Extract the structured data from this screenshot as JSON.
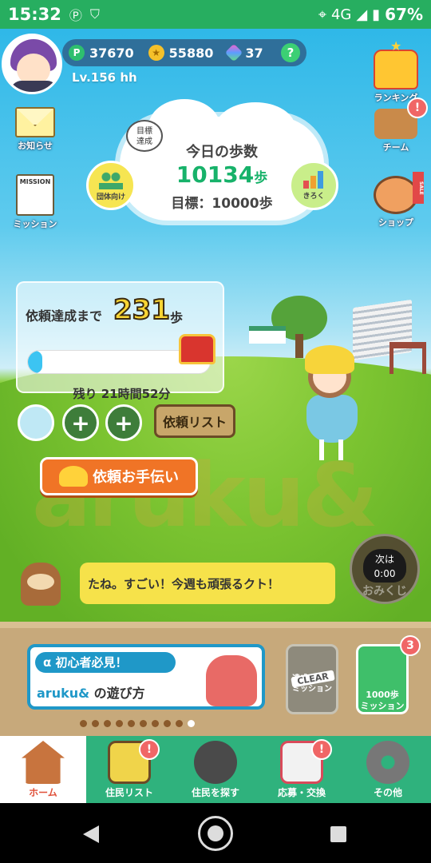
{
  "status": {
    "time": "15:32",
    "network": "4G",
    "battery": "67%"
  },
  "profile": {
    "points": "37670",
    "coins": "55880",
    "gems": "37",
    "level": "Lv.156 hh",
    "help": "?"
  },
  "left_menu": {
    "notice": "お知らせ",
    "mission_icon_text": "MISSION",
    "mission": "ミッション"
  },
  "right_menu": {
    "ranking": "ランキング",
    "team": "チーム",
    "team_badge": "!",
    "shop": "ショップ",
    "shop_sale": "SALE"
  },
  "steps": {
    "achieved_bubble": "目標\n達成",
    "title": "今日の歩数",
    "value": "10134",
    "unit": "歩",
    "goal": "目標：10000歩",
    "group_button": "団体向け",
    "record_button": "きろく"
  },
  "request": {
    "label": "依頼達成まで",
    "remaining": "231",
    "unit": "歩",
    "progress": 0.08,
    "time_left": "残り 21時間52分",
    "list_button": "依頼リスト",
    "help_button": "依頼お手伝い",
    "add_slot": "+"
  },
  "watermark": "aruku&",
  "speech": {
    "text": "たね。すごい！今週も頑張るクト！"
  },
  "omikuji": {
    "line1": "次は",
    "line2": "0:00",
    "label": "おみくじ"
  },
  "banners": {
    "beginner_title": "α 初心者必見！",
    "beginner_brand": "aruku&",
    "beginner_sub": "の遊び方",
    "clear_tag": "CLEAR",
    "clear_label": "達成クリア\nミッション",
    "steps_mission": "1000歩\nミッション",
    "steps_badge": "3"
  },
  "bottom_nav": [
    {
      "label": "ホーム",
      "badge": ""
    },
    {
      "label": "住民リスト",
      "badge": "!"
    },
    {
      "label": "住民を探す",
      "badge": ""
    },
    {
      "label": "応募・交換",
      "badge": "!"
    },
    {
      "label": "その他",
      "badge": ""
    }
  ]
}
